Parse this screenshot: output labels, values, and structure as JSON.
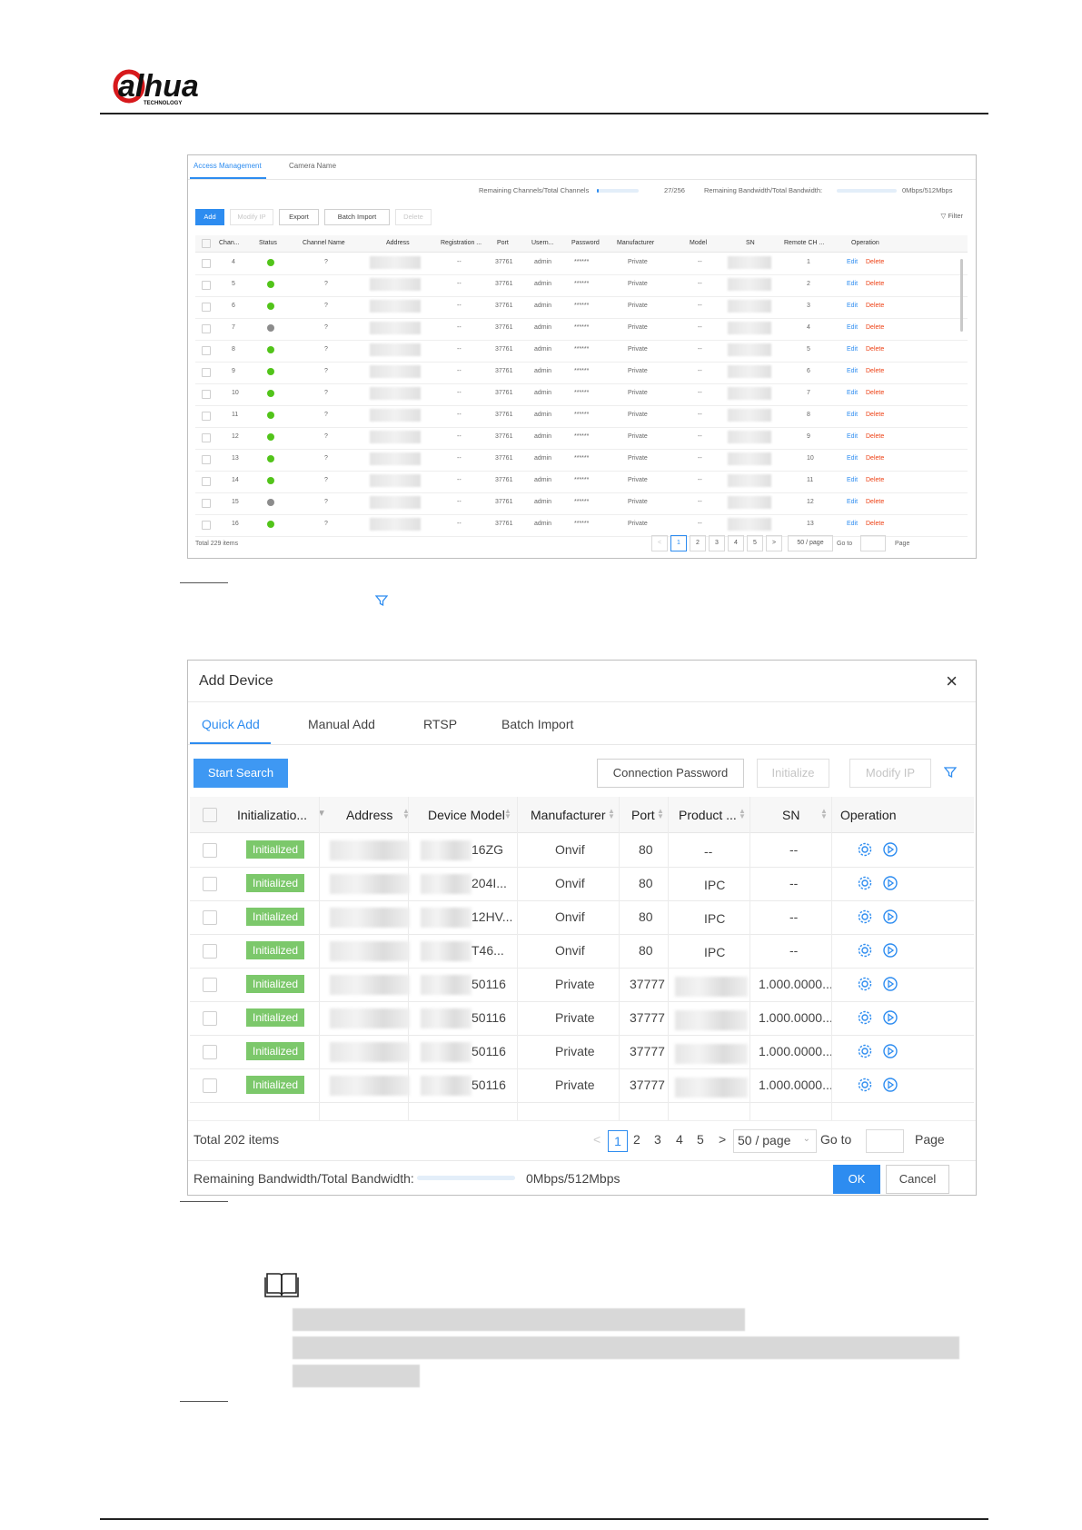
{
  "logo": {
    "brand": "alhua",
    "sub": "TECHNOLOGY"
  },
  "screenshot1": {
    "tabs": [
      "Access Management",
      "Camera Name"
    ],
    "stats": {
      "channels_label": "Remaining Channels/Total Channels",
      "channels_value": "27/256",
      "channels_fill": 0.05,
      "bandwidth_label": "Remaining Bandwidth/Total Bandwidth:",
      "bandwidth_value": "0Mbps/512Mbps"
    },
    "toolbar": [
      "Add",
      "Modify IP",
      "Export",
      "Batch Import",
      "Delete"
    ],
    "filter_label": "Filter",
    "columns": [
      "Chan...",
      "Status",
      "Channel Name",
      "Address",
      "Registration ...",
      "Port",
      "Usern...",
      "Password",
      "Manufacturer",
      "Model",
      "SN",
      "Remote CH ...",
      "Operation"
    ],
    "rows": [
      {
        "ch": "4",
        "status": "online",
        "name": "?",
        "reg": "--",
        "port": "37761",
        "user": "admin",
        "pwd": "******",
        "mfr": "Private",
        "model": "--",
        "remote": "1"
      },
      {
        "ch": "5",
        "status": "online",
        "name": "?",
        "reg": "--",
        "port": "37761",
        "user": "admin",
        "pwd": "******",
        "mfr": "Private",
        "model": "--",
        "remote": "2"
      },
      {
        "ch": "6",
        "status": "online",
        "name": "?",
        "reg": "--",
        "port": "37761",
        "user": "admin",
        "pwd": "******",
        "mfr": "Private",
        "model": "--",
        "remote": "3"
      },
      {
        "ch": "7",
        "status": "offline",
        "name": "?",
        "reg": "--",
        "port": "37761",
        "user": "admin",
        "pwd": "******",
        "mfr": "Private",
        "model": "--",
        "remote": "4"
      },
      {
        "ch": "8",
        "status": "online",
        "name": "?",
        "reg": "--",
        "port": "37761",
        "user": "admin",
        "pwd": "******",
        "mfr": "Private",
        "model": "--",
        "remote": "5"
      },
      {
        "ch": "9",
        "status": "online",
        "name": "?",
        "reg": "--",
        "port": "37761",
        "user": "admin",
        "pwd": "******",
        "mfr": "Private",
        "model": "--",
        "remote": "6"
      },
      {
        "ch": "10",
        "status": "online",
        "name": "?",
        "reg": "--",
        "port": "37761",
        "user": "admin",
        "pwd": "******",
        "mfr": "Private",
        "model": "--",
        "remote": "7"
      },
      {
        "ch": "11",
        "status": "online",
        "name": "?",
        "reg": "--",
        "port": "37761",
        "user": "admin",
        "pwd": "******",
        "mfr": "Private",
        "model": "--",
        "remote": "8"
      },
      {
        "ch": "12",
        "status": "online",
        "name": "?",
        "reg": "--",
        "port": "37761",
        "user": "admin",
        "pwd": "******",
        "mfr": "Private",
        "model": "--",
        "remote": "9"
      },
      {
        "ch": "13",
        "status": "online",
        "name": "?",
        "reg": "--",
        "port": "37761",
        "user": "admin",
        "pwd": "******",
        "mfr": "Private",
        "model": "--",
        "remote": "10"
      },
      {
        "ch": "14",
        "status": "online",
        "name": "?",
        "reg": "--",
        "port": "37761",
        "user": "admin",
        "pwd": "******",
        "mfr": "Private",
        "model": "--",
        "remote": "11"
      },
      {
        "ch": "15",
        "status": "offline",
        "name": "?",
        "reg": "--",
        "port": "37761",
        "user": "admin",
        "pwd": "******",
        "mfr": "Private",
        "model": "--",
        "remote": "12"
      },
      {
        "ch": "16",
        "status": "online",
        "name": "?",
        "reg": "--",
        "port": "37761",
        "user": "admin",
        "pwd": "******",
        "mfr": "Private",
        "model": "--",
        "remote": "13"
      }
    ],
    "op_edit": "Edit",
    "op_delete": "Delete",
    "total": "Total 229 items",
    "pages": [
      "1",
      "2",
      "3",
      "4",
      "5"
    ],
    "page_size": "50 / page",
    "goto": "Go to",
    "page_word": "Page"
  },
  "screenshot2": {
    "title": "Add Device",
    "close": "×",
    "tabs": [
      "Quick Add",
      "Manual Add",
      "RTSP",
      "Batch Import"
    ],
    "buttons": {
      "start_search": "Start Search",
      "connection_password": "Connection Password",
      "initialize": "Initialize",
      "modify_ip": "Modify IP"
    },
    "columns": [
      "Initializatio...",
      "Address",
      "Device Model",
      "Manufacturer",
      "Port",
      "Product ...",
      "SN",
      "Operation"
    ],
    "status_badge": "Initialized",
    "rows": [
      {
        "model": "16ZG",
        "mfr": "Onvif",
        "port": "80",
        "product": "--",
        "sn": "--"
      },
      {
        "model": "204I...",
        "mfr": "Onvif",
        "port": "80",
        "product": "IPC",
        "sn": "--"
      },
      {
        "model": "12HV...",
        "mfr": "Onvif",
        "port": "80",
        "product": "IPC",
        "sn": "--"
      },
      {
        "model": "T46...",
        "mfr": "Onvif",
        "port": "80",
        "product": "IPC",
        "sn": "--"
      },
      {
        "model": "50116",
        "mfr": "Private",
        "port": "37777",
        "product": "",
        "sn": "1.000.0000..."
      },
      {
        "model": "50116",
        "mfr": "Private",
        "port": "37777",
        "product": "",
        "sn": "1.000.0000..."
      },
      {
        "model": "50116",
        "mfr": "Private",
        "port": "37777",
        "product": "",
        "sn": "1.000.0000..."
      },
      {
        "model": "50116",
        "mfr": "Private",
        "port": "37777",
        "product": "",
        "sn": "1.000.0000..."
      }
    ],
    "total": "Total 202 items",
    "pages": [
      "1",
      "2",
      "3",
      "4",
      "5"
    ],
    "page_size": "50 / page",
    "goto": "Go to",
    "page_word": "Page",
    "bandwidth_label": "Remaining Bandwidth/Total Bandwidth:",
    "bandwidth_value": "0Mbps/512Mbps",
    "ok": "OK",
    "cancel": "Cancel"
  },
  "colors": {
    "accent": "#2d8cf0",
    "online": "#52c41a",
    "offline": "#8c8c8c",
    "badge": "#7cc86b",
    "delete": "#ed4014"
  }
}
